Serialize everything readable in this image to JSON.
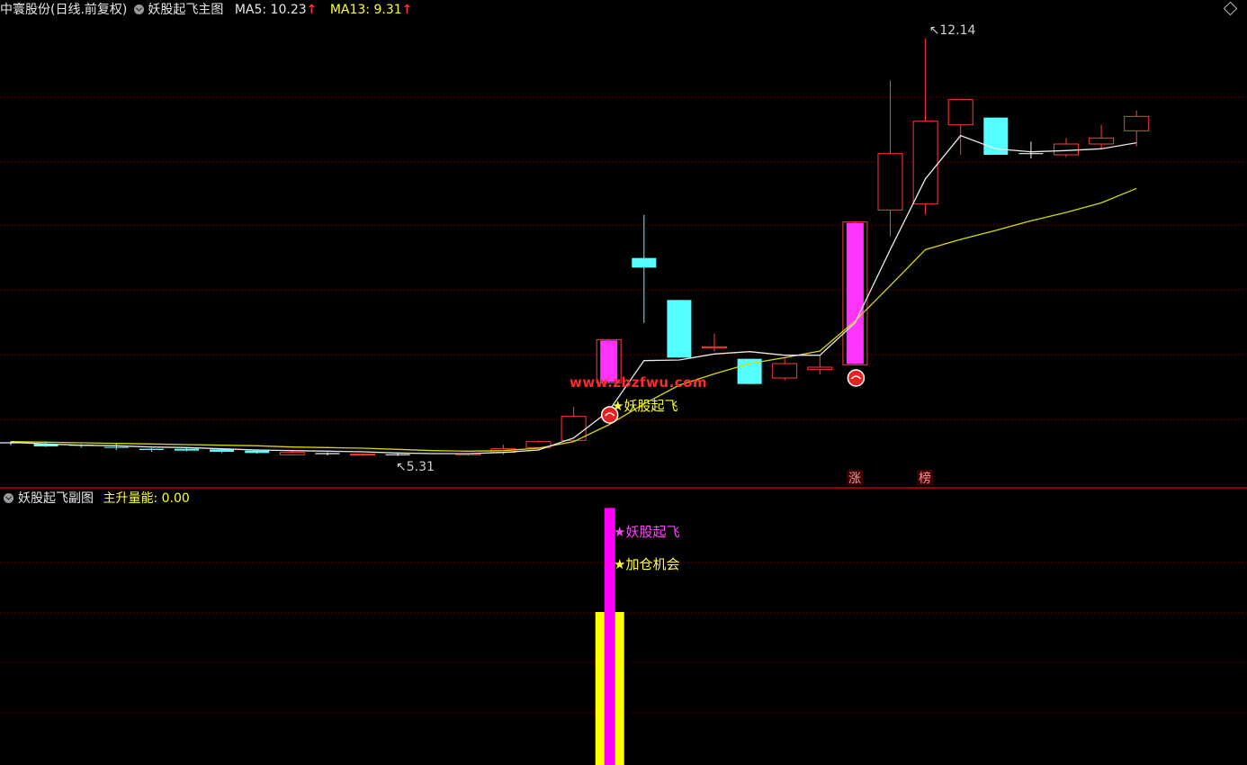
{
  "header": {
    "stock_name": "中寰股份",
    "period_label": "(日线.前复权)",
    "indicator_name": "妖股起飞主图",
    "ma5_label": "MA5: 10.23",
    "ma13_label": "MA13: 9.31",
    "arrow_up": "↑"
  },
  "sub_header": {
    "indicator_name": "妖股起飞副图",
    "energy_label": "主升量能: 0.00"
  },
  "watermark": "www.zbzfwu.com",
  "colors": {
    "background": "#000000",
    "up_candle": "#ff3b3b",
    "down_candle": "#54ffff",
    "signal_candle": "#ff33ff",
    "ma5": "#e8e8e8",
    "ma13": "#d8d800",
    "grid": "#7a0000",
    "separator": "#c00000",
    "yellow_bar": "#ffff00",
    "magenta_bar": "#ff00ff"
  },
  "chart_data": {
    "type": "candlestick",
    "candles": [
      {
        "o": 5.4,
        "h": 5.42,
        "l": 5.36,
        "c": 5.4
      },
      {
        "o": 5.38,
        "h": 5.4,
        "l": 5.33,
        "c": 5.34
      },
      {
        "o": 5.37,
        "h": 5.38,
        "l": 5.32,
        "c": 5.35
      },
      {
        "o": 5.33,
        "h": 5.39,
        "l": 5.28,
        "c": 5.32
      },
      {
        "o": 5.3,
        "h": 5.31,
        "l": 5.25,
        "c": 5.28
      },
      {
        "o": 5.3,
        "h": 5.32,
        "l": 5.26,
        "c": 5.27
      },
      {
        "o": 5.29,
        "h": 5.3,
        "l": 5.23,
        "c": 5.25
      },
      {
        "o": 5.27,
        "h": 5.29,
        "l": 5.22,
        "c": 5.23
      },
      {
        "o": 5.2,
        "h": 5.28,
        "l": 5.19,
        "c": 5.24
      },
      {
        "o": 5.22,
        "h": 5.24,
        "l": 5.19,
        "c": 5.22
      },
      {
        "o": 5.2,
        "h": 5.22,
        "l": 5.18,
        "c": 5.21
      },
      {
        "o": 5.2,
        "h": 5.22,
        "l": 5.18,
        "c": 5.2
      },
      {
        "o": 5.31,
        "h": 5.31,
        "l": 5.31,
        "c": 5.31
      },
      {
        "o": 5.2,
        "h": 5.23,
        "l": 5.18,
        "c": 5.22
      },
      {
        "o": 5.24,
        "h": 5.37,
        "l": 5.2,
        "c": 5.3
      },
      {
        "o": 5.32,
        "h": 5.44,
        "l": 5.28,
        "c": 5.42
      },
      {
        "o": 5.44,
        "h": 6.0,
        "l": 5.42,
        "c": 5.84
      },
      {
        "o": 6.4,
        "h": 7.12,
        "l": 6.4,
        "c": 7.12,
        "signal": true
      },
      {
        "o": 8.48,
        "h": 9.2,
        "l": 7.4,
        "c": 8.32
      },
      {
        "o": 7.78,
        "h": 7.78,
        "l": 6.82,
        "c": 6.82
      },
      {
        "o": 6.98,
        "h": 7.22,
        "l": 6.92,
        "c": 7.0
      },
      {
        "o": 6.8,
        "h": 6.8,
        "l": 6.38,
        "c": 6.38
      },
      {
        "o": 6.48,
        "h": 6.82,
        "l": 6.44,
        "c": 6.72
      },
      {
        "o": 6.62,
        "h": 6.86,
        "l": 6.54,
        "c": 6.66
      },
      {
        "o": 6.7,
        "h": 9.08,
        "l": 6.7,
        "c": 9.08,
        "signal": true
      },
      {
        "o": 9.28,
        "h": 11.44,
        "l": 8.84,
        "c": 10.22
      },
      {
        "o": 9.38,
        "h": 12.14,
        "l": 9.2,
        "c": 10.76
      },
      {
        "o": 10.7,
        "h": 11.12,
        "l": 10.2,
        "c": 11.12
      },
      {
        "o": 10.82,
        "h": 10.82,
        "l": 10.2,
        "c": 10.2
      },
      {
        "o": 10.22,
        "h": 10.42,
        "l": 10.14,
        "c": 10.22
      },
      {
        "o": 10.2,
        "h": 10.48,
        "l": 10.16,
        "c": 10.38
      },
      {
        "o": 10.38,
        "h": 10.7,
        "l": 10.3,
        "c": 10.48
      },
      {
        "o": 10.6,
        "h": 10.94,
        "l": 10.34,
        "c": 10.84
      }
    ],
    "ma5": [
      5.41,
      5.38,
      5.36,
      5.35,
      5.33,
      5.32,
      5.3,
      5.28,
      5.27,
      5.26,
      5.25,
      5.23,
      5.22,
      5.22,
      5.24,
      5.28,
      5.48,
      5.93,
      6.77,
      6.78,
      6.88,
      6.92,
      6.86,
      6.86,
      7.4,
      8.62,
      9.8,
      10.52,
      10.3,
      10.25,
      10.27,
      10.3,
      10.4
    ],
    "ma13": [
      5.42,
      5.41,
      5.4,
      5.39,
      5.38,
      5.37,
      5.36,
      5.35,
      5.33,
      5.32,
      5.31,
      5.29,
      5.27,
      5.26,
      5.27,
      5.31,
      5.42,
      5.7,
      6.05,
      6.36,
      6.55,
      6.72,
      6.82,
      6.93,
      7.43,
      8.02,
      8.62,
      8.79,
      8.94,
      9.1,
      9.24,
      9.4,
      9.64
    ],
    "annotations": {
      "high_label": "12.14",
      "low_label": "5.31",
      "signal_label": "★妖股起飞",
      "badge_1": "涨",
      "badge_2": "榜",
      "sub_signal_1": "★妖股起飞",
      "sub_signal_2": "★加仓机会"
    },
    "sub_bars": [
      {
        "index": 17,
        "series": "yellow",
        "value": 1.0
      },
      {
        "index": 17,
        "series": "magenta",
        "value": 1.68
      }
    ]
  }
}
